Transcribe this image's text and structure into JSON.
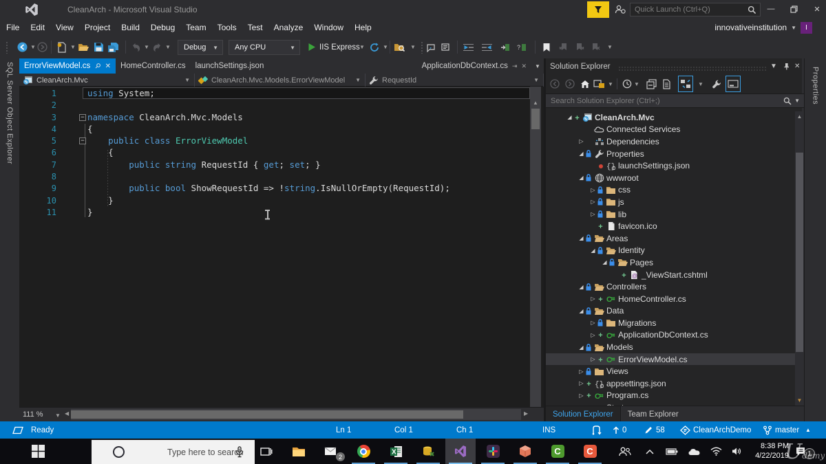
{
  "titlebar": {
    "title": "CleanArch - Microsoft Visual Studio",
    "quick_launch_placeholder": "Quick Launch (Ctrl+Q)"
  },
  "menubar": {
    "items": [
      "File",
      "Edit",
      "View",
      "Project",
      "Build",
      "Debug",
      "Team",
      "Tools",
      "Test",
      "Analyze",
      "Window",
      "Help"
    ],
    "user": "innovativeinstitution",
    "avatar_letter": "I"
  },
  "toolbar": {
    "config": "Debug",
    "platform": "Any CPU",
    "run": "IIS Express"
  },
  "left_strip_label": "SQL Server Object Explorer",
  "right_strip_label": "Properties",
  "editor_tabs": [
    {
      "label": "ErrorViewModel.cs",
      "state": "active"
    },
    {
      "label": "HomeController.cs",
      "state": "normal"
    },
    {
      "label": "launchSettings.json",
      "state": "normal"
    },
    {
      "label": "ApplicationDbContext.cs",
      "state": "preview"
    }
  ],
  "breadcrumb": [
    {
      "icon": "project",
      "label": "CleanArch.Mvc"
    },
    {
      "icon": "class",
      "label": "CleanArch.Mvc.Models.ErrorViewModel"
    },
    {
      "icon": "wrench",
      "label": "RequestId"
    }
  ],
  "editor": {
    "zoom_level": "111 %",
    "lines": [
      {
        "n": 1,
        "current": true,
        "code": [
          [
            "k",
            "using"
          ],
          [
            "p",
            " System;"
          ]
        ]
      },
      {
        "n": 2,
        "code": []
      },
      {
        "n": 3,
        "fold": true,
        "code": [
          [
            "k",
            "namespace"
          ],
          [
            "p",
            " CleanArch.Mvc.Models"
          ]
        ]
      },
      {
        "n": 4,
        "code": [
          [
            "p",
            "{"
          ]
        ]
      },
      {
        "n": 5,
        "fold": true,
        "code": [
          [
            "p",
            "    "
          ],
          [
            "k",
            "public"
          ],
          [
            "p",
            " "
          ],
          [
            "k",
            "class"
          ],
          [
            "p",
            " "
          ],
          [
            "t",
            "ErrorViewModel"
          ]
        ]
      },
      {
        "n": 6,
        "code": [
          [
            "p",
            "    {"
          ]
        ]
      },
      {
        "n": 7,
        "code": [
          [
            "p",
            "        "
          ],
          [
            "k",
            "public"
          ],
          [
            "p",
            " "
          ],
          [
            "k",
            "string"
          ],
          [
            "p",
            " RequestId { "
          ],
          [
            "k",
            "get"
          ],
          [
            "p",
            "; "
          ],
          [
            "k",
            "set"
          ],
          [
            "p",
            "; }"
          ]
        ]
      },
      {
        "n": 8,
        "code": []
      },
      {
        "n": 9,
        "code": [
          [
            "p",
            "        "
          ],
          [
            "k",
            "public"
          ],
          [
            "p",
            " "
          ],
          [
            "k",
            "bool"
          ],
          [
            "p",
            " ShowRequestId => !"
          ],
          [
            "k",
            "string"
          ],
          [
            "p",
            ".IsNullOrEmpty(RequestId);"
          ]
        ]
      },
      {
        "n": 10,
        "code": [
          [
            "p",
            "    }"
          ]
        ]
      },
      {
        "n": 11,
        "code": [
          [
            "p",
            "}"
          ]
        ]
      }
    ]
  },
  "solution_explorer": {
    "title": "Solution Explorer",
    "search_placeholder": "Search Solution Explorer (Ctrl+;)",
    "bottom_tabs": [
      "Solution Explorer",
      "Team Explorer"
    ],
    "tree": [
      {
        "label": "CleanArch.Mvc",
        "level": 0,
        "expand": "open",
        "status": "plus",
        "icon": "project",
        "bold": true
      },
      {
        "label": "Connected Services",
        "level": 1,
        "icon": "cloud"
      },
      {
        "label": "Dependencies",
        "level": 1,
        "expand": "closed",
        "icon": "deps"
      },
      {
        "label": "Properties",
        "level": 1,
        "expand": "open",
        "status": "lock",
        "icon": "wrench"
      },
      {
        "label": "launchSettings.json",
        "level": 2,
        "status": "dot",
        "icon": "json"
      },
      {
        "label": "wwwroot",
        "level": 1,
        "expand": "open",
        "status": "lock",
        "icon": "globe"
      },
      {
        "label": "css",
        "level": 2,
        "expand": "closed",
        "status": "lock",
        "icon": "folder"
      },
      {
        "label": "js",
        "level": 2,
        "expand": "closed",
        "status": "lock",
        "icon": "folder"
      },
      {
        "label": "lib",
        "level": 2,
        "expand": "closed",
        "status": "lock",
        "icon": "folder"
      },
      {
        "label": "favicon.ico",
        "level": 2,
        "status": "plus",
        "icon": "file"
      },
      {
        "label": "Areas",
        "level": 1,
        "expand": "open",
        "status": "lock",
        "icon": "folderopen"
      },
      {
        "label": "Identity",
        "level": 2,
        "expand": "open",
        "status": "lock",
        "icon": "folderopen"
      },
      {
        "label": "Pages",
        "level": 3,
        "expand": "open",
        "status": "lock",
        "icon": "folderopen"
      },
      {
        "label": "_ViewStart.cshtml",
        "level": 4,
        "status": "plus",
        "icon": "razor"
      },
      {
        "label": "Controllers",
        "level": 1,
        "expand": "open",
        "status": "lock",
        "icon": "folderopen"
      },
      {
        "label": "HomeController.cs",
        "level": 2,
        "expand": "closed",
        "status": "plus",
        "icon": "cs"
      },
      {
        "label": "Data",
        "level": 1,
        "expand": "open",
        "status": "lock",
        "icon": "folderopen"
      },
      {
        "label": "Migrations",
        "level": 2,
        "expand": "closed",
        "status": "lock",
        "icon": "folder"
      },
      {
        "label": "ApplicationDbContext.cs",
        "level": 2,
        "expand": "closed",
        "status": "plus",
        "icon": "cs"
      },
      {
        "label": "Models",
        "level": 1,
        "expand": "open",
        "status": "lock",
        "icon": "folderopen"
      },
      {
        "label": "ErrorViewModel.cs",
        "level": 2,
        "expand": "closed",
        "status": "plus",
        "icon": "cs",
        "selected": true
      },
      {
        "label": "Views",
        "level": 1,
        "expand": "closed",
        "status": "lock",
        "icon": "folder"
      },
      {
        "label": "appsettings.json",
        "level": 1,
        "expand": "closed",
        "status": "plus",
        "icon": "json"
      },
      {
        "label": "Program.cs",
        "level": 1,
        "expand": "closed",
        "status": "plus",
        "icon": "cs"
      },
      {
        "label": "Startup.cs",
        "level": 1,
        "expand": "closed",
        "status": "plus",
        "icon": "cs"
      }
    ]
  },
  "statusbar": {
    "ready": "Ready",
    "line": "Ln 1",
    "column": "Col 1",
    "character": "Ch 1",
    "mode": "INS",
    "incoming": "0",
    "changes": "58",
    "repository": "CleanArchDemo",
    "branch": "master"
  },
  "taskbar": {
    "search_placeholder": "Type here to search",
    "mail_badge": "2",
    "time": "8:38 PM",
    "date": "4/22/2019",
    "watermark": "Udemy",
    "watermark_badge": "1"
  }
}
